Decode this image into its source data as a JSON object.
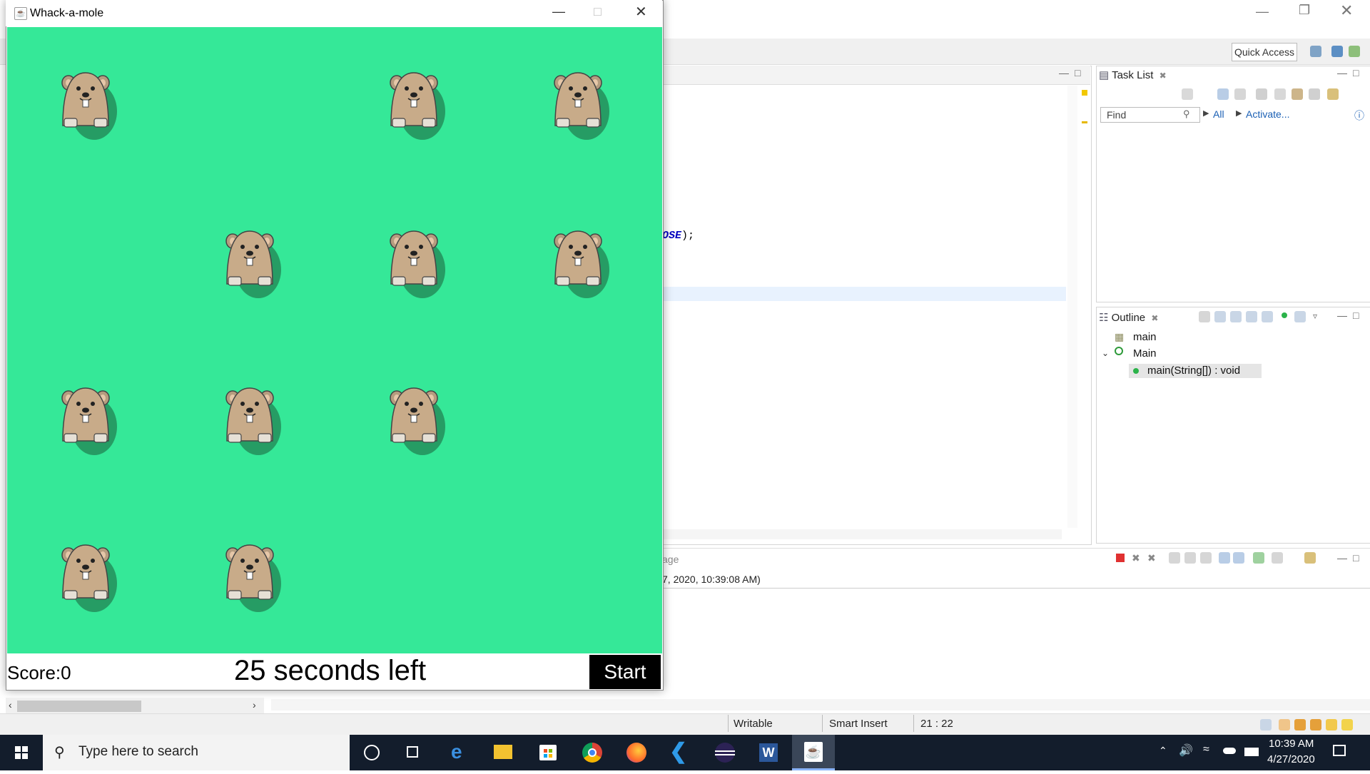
{
  "java_window": {
    "title": "Whack-a-mole",
    "score_label": "Score:",
    "score_value": "0",
    "timer_text": "25 seconds left",
    "start_button": "Start",
    "bg_color": "#35e898",
    "moles": [
      {
        "row": 0,
        "col": 0
      },
      {
        "row": 0,
        "col": 2
      },
      {
        "row": 0,
        "col": 3
      },
      {
        "row": 1,
        "col": 1
      },
      {
        "row": 1,
        "col": 2
      },
      {
        "row": 1,
        "col": 3
      },
      {
        "row": 2,
        "col": 0
      },
      {
        "row": 2,
        "col": 1
      },
      {
        "row": 2,
        "col": 2
      },
      {
        "row": 3,
        "col": 0
      },
      {
        "row": 3,
        "col": 1
      }
    ]
  },
  "eclipse": {
    "quick_access": "Quick Access",
    "code_fragment_keyword": "OSE",
    "code_fragment_rest": ");",
    "task_list": {
      "tab": "Task List",
      "find_placeholder": "Find",
      "all_link": "All",
      "activate_link": "Activate..."
    },
    "outline": {
      "tab": "Outline",
      "items": [
        "main",
        "Main",
        "main(String[]) : void"
      ]
    },
    "console": {
      "tab_fragment": "age",
      "line": "7, 2020, 10:39:08 AM)"
    },
    "status": {
      "writable": "Writable",
      "insert_mode": "Smart Insert",
      "position": "21 : 22"
    }
  },
  "taskbar": {
    "search_placeholder": "Type here to search",
    "time": "10:39 AM",
    "date": "4/27/2020",
    "apps": [
      "cortana-icon",
      "task-view-icon",
      "edge-icon",
      "file-explorer-icon",
      "store-icon",
      "chrome-icon",
      "firefox-icon",
      "vscode-icon",
      "eclipse-icon",
      "word-icon",
      "java-icon"
    ]
  }
}
